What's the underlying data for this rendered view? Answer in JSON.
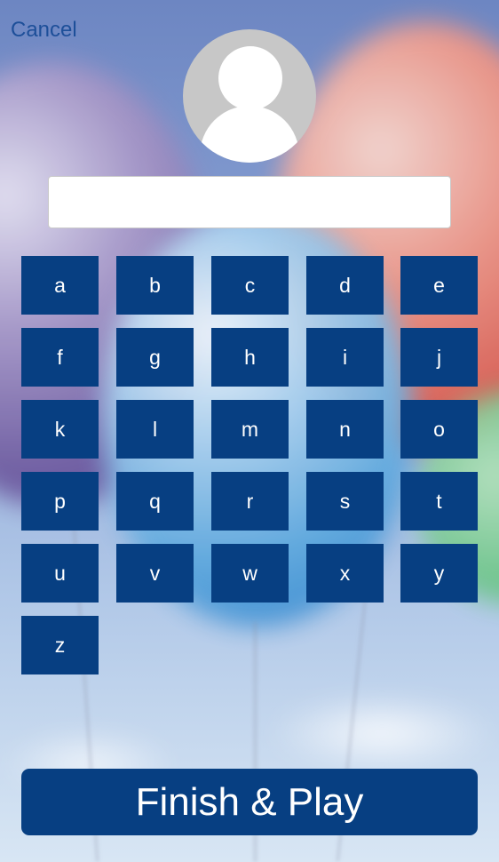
{
  "header": {
    "cancel_label": "Cancel"
  },
  "profile": {
    "avatar_icon": "default-user-icon",
    "name_value": ""
  },
  "keypad": {
    "keys": [
      "a",
      "b",
      "c",
      "d",
      "e",
      "f",
      "g",
      "h",
      "i",
      "j",
      "k",
      "l",
      "m",
      "n",
      "o",
      "p",
      "q",
      "r",
      "s",
      "t",
      "u",
      "v",
      "w",
      "x",
      "y",
      "z"
    ]
  },
  "footer": {
    "finish_label": "Finish & Play"
  },
  "colors": {
    "key_background": "#073f82",
    "cancel_text": "#1d4f99"
  }
}
